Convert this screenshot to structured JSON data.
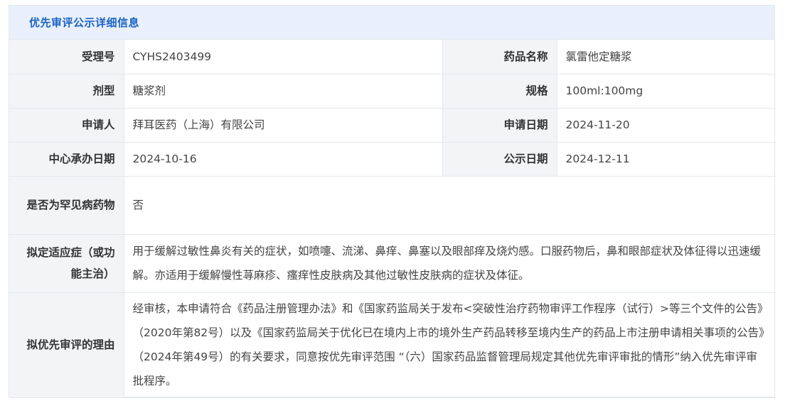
{
  "header": {
    "title": "优先审评公示详细信息"
  },
  "fields": {
    "accept_no": {
      "label": "受理号",
      "value": "CYHS2403499"
    },
    "drug_name": {
      "label": "药品名称",
      "value": "氯雷他定糖浆"
    },
    "dosage_form": {
      "label": "剂型",
      "value": "糖浆剂"
    },
    "spec": {
      "label": "规格",
      "value": "100ml:100mg"
    },
    "applicant": {
      "label": "申请人",
      "value": "拜耳医药（上海）有限公司"
    },
    "apply_date": {
      "label": "申请日期",
      "value": "2024-11-20"
    },
    "center_date": {
      "label": "中心承办日期",
      "value": "2024-10-16"
    },
    "publish_date": {
      "label": "公示日期",
      "value": "2024-12-11"
    },
    "rare_disease": {
      "label": "是否为罕见病药物",
      "value": "否"
    },
    "indication": {
      "label": "拟定适应症（或功能主治）",
      "value": "用于缓解过敏性鼻炎有关的症状，如喷嚏、流涕、鼻痒、鼻塞以及眼部痒及烧灼感。口服药物后，鼻和眼部症状及体征得以迅速缓解。亦适用于缓解慢性荨麻疹、瘙痒性皮肤病及其他过敏性皮肤病的症状及体征。"
    },
    "reason": {
      "label": "拟优先审评的理由",
      "value": "经审核，本申请符合《药品注册管理办法》和《国家药监局关于发布<突破性治疗药物审评工作程序（试行）>等三个文件的公告》（2020年第82号）以及《国家药监局关于优化已在境内上市的境外生产药品转移至境内生产的药品上市注册申请相关事项的公告》（2024年第49号）的有关要求，同意按优先审评范围 “（六）国家药品监督管理局规定其他优先审评审批的情形”纳入优先审评审批程序。"
    }
  }
}
